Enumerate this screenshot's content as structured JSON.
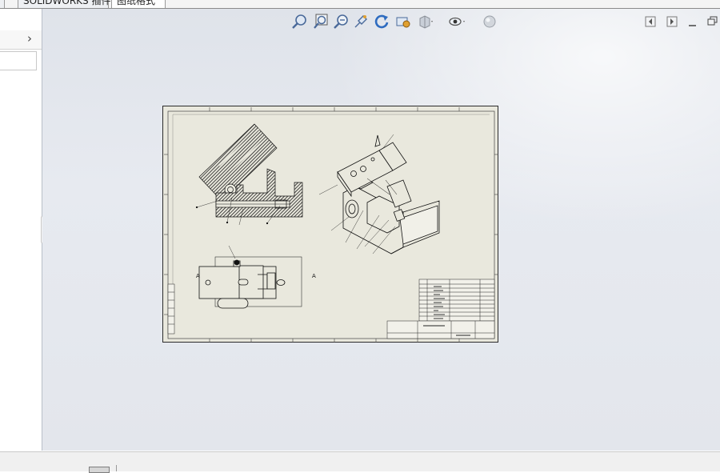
{
  "tabs": [
    {
      "label": "SOLIDWORKS 插件"
    },
    {
      "label": "图纸格式"
    }
  ],
  "heads_up_toolbar": {
    "icons": [
      "zoom-to-fit-icon",
      "zoom-to-area-icon",
      "zoom-in-out-icon",
      "pan-icon",
      "rotate-icon",
      "apply-scene-icon",
      "display-style-icon",
      "hide-show-items-icon",
      "appearance-icon"
    ]
  },
  "window_controls": {
    "icons": [
      "view-prev-icon",
      "view-next-icon",
      "minimize-icon",
      "restore-icon"
    ]
  },
  "accent_colors": {
    "sheet_background": "#e9e8dd",
    "graphics_background": "#e4e7ed",
    "hatch_color": "#1a1a1a"
  }
}
